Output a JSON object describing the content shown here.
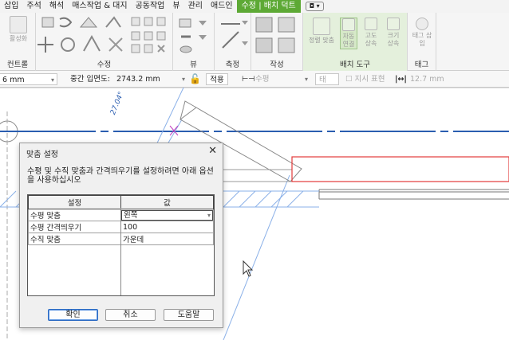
{
  "menu": {
    "items": [
      "삽입",
      "주석",
      "해석",
      "매스작업 & 대지",
      "공동작업",
      "뷰",
      "관리",
      "애드인"
    ],
    "active_tab": "수정 | 배치 덕트",
    "extra_icon": "◘ ▾"
  },
  "ribbon": {
    "panels": {
      "select": "컨트롤",
      "modify": "수정",
      "view": "뷰",
      "measure": "측정",
      "create": "작성",
      "placement": "배치 도구",
      "tag": "태그"
    },
    "tools": {
      "activate": "활성화",
      "justify": "정렬 맞춤",
      "auto_connect": "자동 연결",
      "inherit_elev": "고도 상속",
      "inherit_size": "크기 상속",
      "tag_on_place": "태그 삽입"
    }
  },
  "options_bar": {
    "left_value": "6 mm",
    "middle_elev_label": "중간 입면도:",
    "middle_elev_value": "2743.2 mm",
    "apply_button": "적용",
    "horizontal_dropdown": "수평",
    "tag_dropdown": "태그...",
    "leader_checkbox": "지시 표현",
    "leader_length": "12.7 mm"
  },
  "canvas": {
    "angle_label": "27.04°"
  },
  "dialog": {
    "title": "맞춤 설정",
    "description": "수평 및 수직 맞춤과 간격띄우기를 설정하려면 아래 옵션을 사용하십시오",
    "headers": [
      "설정",
      "값"
    ],
    "rows": [
      {
        "setting": "수평 맞춤",
        "value": "왼쪽"
      },
      {
        "setting": "수평 간격띄우기",
        "value": "100"
      },
      {
        "setting": "수직 맞춤",
        "value": "가운데"
      }
    ],
    "buttons": {
      "ok": "확인",
      "cancel": "취소",
      "help": "도움말"
    }
  },
  "colors": {
    "accent_green": "#5da935",
    "panel_green": "#e4f0dc",
    "grid_blue": "#2a5db0",
    "duct_red": "#e23b3b",
    "ok_border": "#2d6cc4"
  }
}
